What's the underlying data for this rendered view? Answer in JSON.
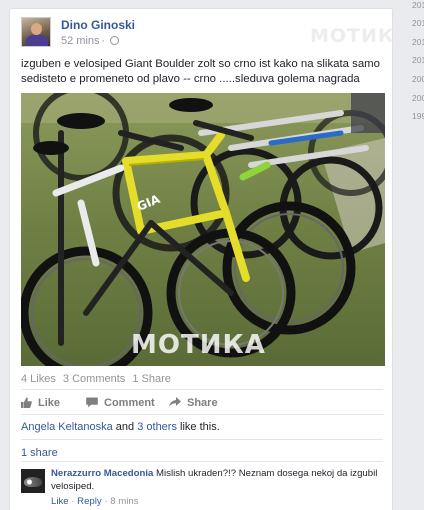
{
  "post": {
    "author": "Dino Ginoski",
    "time": "52 mins",
    "separator": "·",
    "text": "izguben e velosiped Giant Boulder zolt so crno ist kako na slikata samo sedisteto e promeneto od plavo -- crno .....sleduva golema nagrada",
    "watermark_top": "МОТИКА",
    "watermark_photo": "МОТИКА"
  },
  "stats": {
    "likes": "4 Likes",
    "comments": "3 Comments",
    "shares": "1 Share"
  },
  "actions": {
    "like": "Like",
    "comment": "Comment",
    "share": "Share"
  },
  "likes_line": {
    "name": "Angela Keltanoska",
    "and": "and",
    "others": "3 others",
    "suffix": "like this."
  },
  "share_count": "1 share",
  "comment": {
    "author": "Nerazzurro Macedonia",
    "text": "Mislish ukraden?!? Neznam dosega nekoj da izgubil velosiped.",
    "like": "Like",
    "reply": "Reply",
    "dot": "·",
    "time": "8 mins"
  },
  "sidebar_years": [
    "201",
    "201",
    "201",
    "201",
    "200",
    "200",
    "199"
  ],
  "colors": {
    "link": "#365899",
    "muted": "#90949c",
    "bike_yellow": "#e4dd2a",
    "grass": "#7b8b52"
  },
  "icons": {
    "privacy": "globe-icon",
    "like": "thumbs-up-icon",
    "comment": "speech-bubble-icon",
    "share": "share-arrow-icon"
  }
}
